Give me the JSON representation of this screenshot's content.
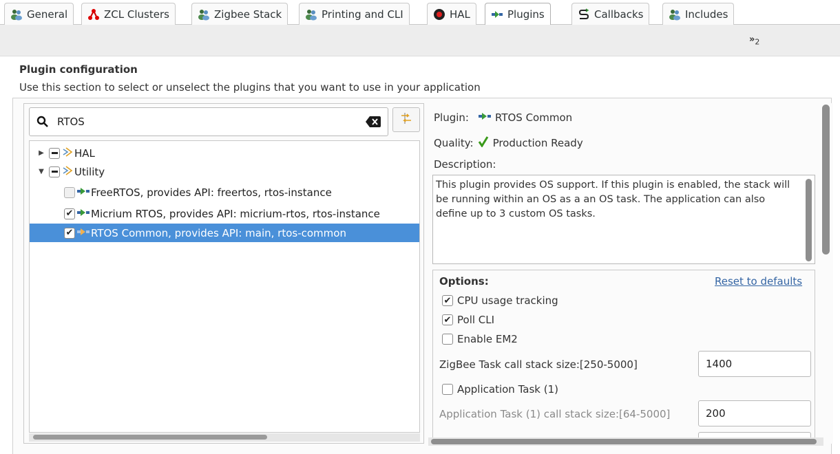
{
  "tabs": [
    {
      "label": "General",
      "icon": "people-icon"
    },
    {
      "label": "ZCL Clusters",
      "icon": "cluster-icon"
    },
    {
      "label": "Zigbee Stack",
      "icon": "people-icon"
    },
    {
      "label": "Printing and CLI",
      "icon": "people-icon"
    },
    {
      "label": "HAL",
      "icon": "record-icon"
    },
    {
      "label": "Plugins",
      "icon": "plugin-icon",
      "active": true
    },
    {
      "label": "Callbacks",
      "icon": "callback-icon"
    },
    {
      "label": "Includes",
      "icon": "people-icon"
    }
  ],
  "overflow": {
    "chevron": "»",
    "count": "2"
  },
  "section": {
    "title": "Plugin configuration",
    "description": "Use this section to select or unselect the plugins that you want to use in your application"
  },
  "search": {
    "value": "RTOS",
    "placeholder": ""
  },
  "tree": {
    "groups": [
      {
        "label": "HAL",
        "expanded": false,
        "state": "mixed"
      },
      {
        "label": "Utility",
        "expanded": true,
        "state": "mixed"
      }
    ],
    "items": [
      {
        "label": "FreeRTOS, provides API: freertos, rtos-instance",
        "checked": false,
        "selected": false
      },
      {
        "label": "Micrium RTOS, provides API: micrium-rtos, rtos-instance",
        "checked": true,
        "selected": false
      },
      {
        "label": "RTOS Common, provides API: main, rtos-common",
        "checked": true,
        "selected": true
      }
    ]
  },
  "details": {
    "plugin_label": "Plugin:",
    "plugin_name": "RTOS Common",
    "quality_label": "Quality:",
    "quality_value": "Production Ready",
    "description_label": "Description:",
    "description_text": "This plugin provides OS support. If this plugin is enabled, the stack will be running within an OS as a an OS task. The application can also define up to 3 custom OS tasks."
  },
  "options": {
    "title": "Options:",
    "reset_label": "Reset to defaults",
    "cpu_usage": {
      "label": "CPU usage tracking",
      "checked": true
    },
    "poll_cli": {
      "label": "Poll CLI",
      "checked": true
    },
    "enable_em2": {
      "label": "Enable EM2",
      "checked": false
    },
    "zigbee_stack_label": "ZigBee Task call stack size:[250-5000]",
    "zigbee_stack_value": "1400",
    "app_task": {
      "label": "Application Task (1)",
      "checked": false
    },
    "app_stack_label": "Application Task (1) call stack size:[64-5000]",
    "app_stack_value": "200"
  },
  "colors": {
    "selection": "#4a90d9",
    "link": "#3465a4"
  }
}
